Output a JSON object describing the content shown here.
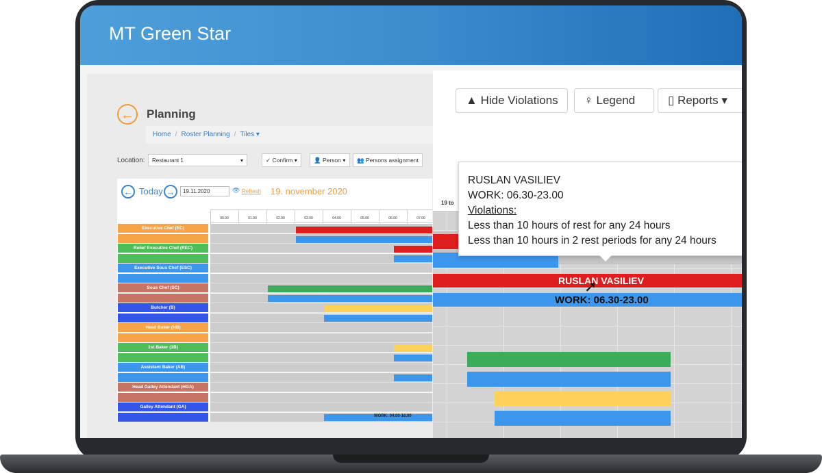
{
  "app": {
    "title": "MT Green Star"
  },
  "page": {
    "title": "Planning"
  },
  "breadcrumb": {
    "home": "Home",
    "roster": "Roster Planning",
    "tiles": "Tiles ▾"
  },
  "filters": {
    "location_label": "Location:",
    "location_value": "Restaurant 1",
    "confirm": "Confirm",
    "person": "Person",
    "persons_assignment": "Persons assignment"
  },
  "nav": {
    "today": "Today",
    "date_input": "19.11.2020",
    "refresh": "Refresh",
    "date_label": "19. november 2020"
  },
  "time_ticks": [
    "00.00",
    "01.00",
    "02.00",
    "03.00",
    "04.00",
    "05.00",
    "06.00",
    "07.00"
  ],
  "roles": [
    {
      "label": "Executive Chef (EC)",
      "color": "#f7a347"
    },
    {
      "label": "Relief Executive Chef (REC)",
      "color": "#4fbd58"
    },
    {
      "label": "Executive Sous Chef (ESC)",
      "color": "#3c96ec"
    },
    {
      "label": "Sous Chef (SC)",
      "color": "#c87464"
    },
    {
      "label": "Butcher (B)",
      "color": "#3456e6"
    },
    {
      "label": "Head Baker (HB)",
      "color": "#f7a347"
    },
    {
      "label": "1st Baker (1B)",
      "color": "#4fbd58"
    },
    {
      "label": "Assistant Baker (AB)",
      "color": "#3c96ec"
    },
    {
      "label": "Head Galley Attendant (HGA)",
      "color": "#c87464"
    },
    {
      "label": "Galley Attendant (GA)",
      "color": "#3456e6"
    }
  ],
  "small_bar_label": "WORK: 04.00-16.00",
  "toolbar": {
    "hide_violations": "Hide Violations",
    "legend": "Legend",
    "reports": "Reports"
  },
  "zoom_header": "19 to",
  "tooltip": {
    "name": "RUSLAN VASILIEV",
    "work": "WORK: 06.30-23.00",
    "violations_title": "Violations:",
    "violation_1": "Less than 10 hours of rest for any 24 hours",
    "violation_2": "Less than 10 hours in 2 rest periods for any 24 hours"
  },
  "zoom_bars": {
    "name": "RUSLAN VASILIEV",
    "work": "WORK: 06.30-23.00"
  },
  "colors": {
    "red": "#de1e1e",
    "blue": "#3c96ec",
    "green": "#3cab5a",
    "yellow": "#fdd25a",
    "orange": "#f39c36"
  }
}
